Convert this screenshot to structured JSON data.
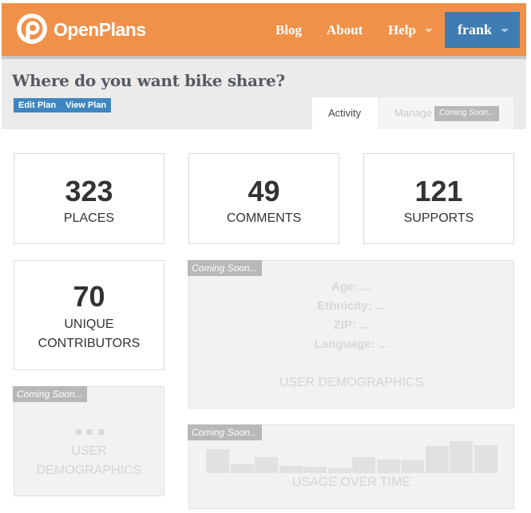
{
  "header": {
    "brand": "OpenPlans",
    "nav": [
      "Blog",
      "About",
      "Help"
    ],
    "user": "frank"
  },
  "plan": {
    "title": "Where do you want bike share?",
    "buttons": {
      "edit": "Edit Plan",
      "view": "View Plan"
    },
    "tabs": {
      "activity": "Activity",
      "manage": "Manage",
      "manage_badge": "Coming Soon..."
    }
  },
  "stats": {
    "places": {
      "value": "323",
      "label": "PLACES"
    },
    "comments": {
      "value": "49",
      "label": "COMMENTS"
    },
    "supports": {
      "value": "121",
      "label": "SUPPORTS"
    },
    "contributors": {
      "value": "70",
      "label_line1": "UNIQUE",
      "label_line2": "CONTRIBUTORS"
    }
  },
  "demographics": {
    "badge": "Coming Soon...",
    "lines": [
      "Age: ...",
      "Ethnicity: ...",
      "ZIP: ...",
      "Language: ..."
    ],
    "label": "USER DEMOGRAPHICS"
  },
  "small_demographics": {
    "badge": "Coming Soon...",
    "label_line1": "USER",
    "label_line2": "DEMOGRAPHICS"
  },
  "usage": {
    "badge": "Coming Soon...",
    "label": "USAGE OVER TIME",
    "levels": [
      1.0,
      0.35,
      0.65,
      0.3,
      0.27,
      0.2,
      0.65,
      0.58,
      0.52,
      1.13,
      1.33,
      1.17
    ]
  },
  "colors": {
    "header": "#f0914a",
    "user_button": "#3e7cb1",
    "action_button": "#3e86c0"
  }
}
